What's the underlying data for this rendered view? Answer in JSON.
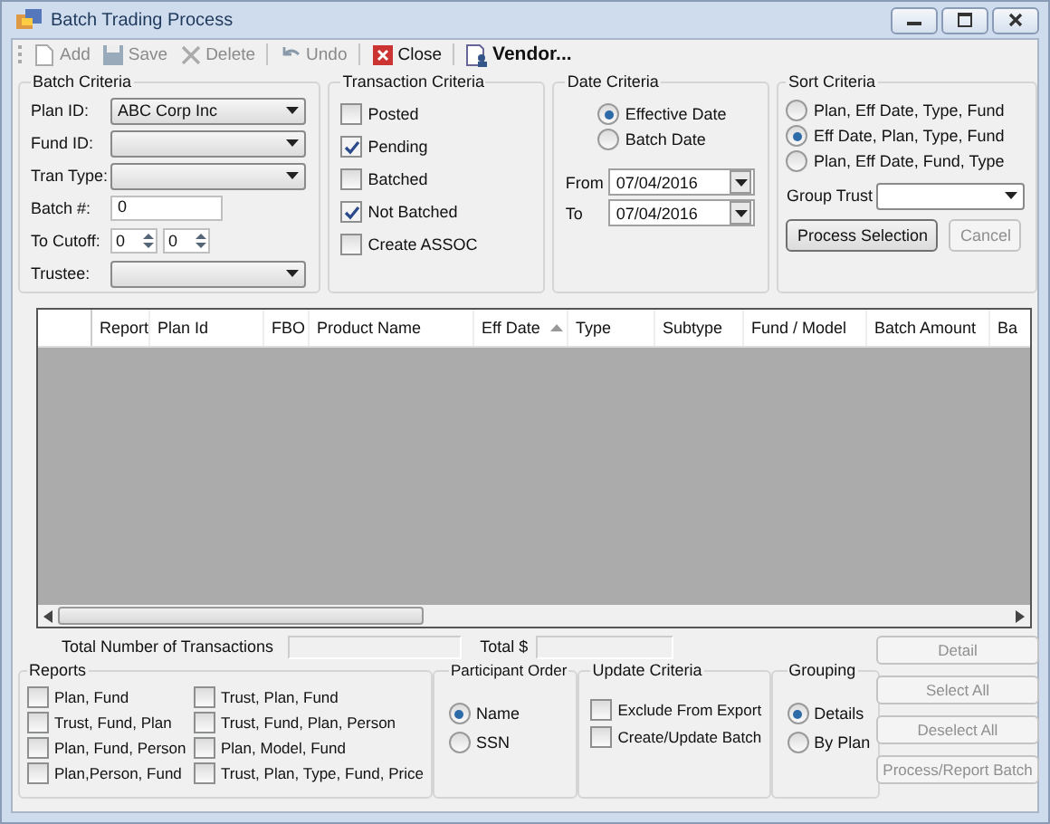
{
  "window": {
    "title": "Batch Trading  Process"
  },
  "toolbar": [
    {
      "kind": "add",
      "label": "Add",
      "disabled": true
    },
    {
      "kind": "save",
      "label": "Save",
      "disabled": true
    },
    {
      "kind": "delete",
      "label": "Delete",
      "disabled": true
    },
    {
      "kind": "undo",
      "label": "Undo",
      "disabled": true
    },
    {
      "kind": "close",
      "label": "Close",
      "disabled": false
    },
    {
      "kind": "vendor",
      "label": "Vendor...",
      "disabled": false
    }
  ],
  "batch_criteria": {
    "title": "Batch Criteria",
    "fields": [
      {
        "kind": "combo",
        "label": "Plan ID:",
        "value": "ABC Corp Inc"
      },
      {
        "kind": "combo",
        "label": "Fund ID:"
      },
      {
        "kind": "combo",
        "label": "Tran Type:"
      },
      {
        "kind": "text",
        "label": "Batch #:",
        "value": "0"
      },
      {
        "kind": "spin",
        "label": "To Cutoff:",
        "values": [
          "0",
          "0"
        ]
      },
      {
        "kind": "combo",
        "label": "Trustee:"
      }
    ]
  },
  "transaction_criteria": {
    "title": "Transaction Criteria",
    "checkboxes": [
      {
        "label": "Posted",
        "checked": false
      },
      {
        "label": "Pending",
        "checked": true
      },
      {
        "label": "Batched",
        "checked": false
      },
      {
        "label": "Not Batched",
        "checked": true
      },
      {
        "label": "Create ASSOC",
        "checked": false
      }
    ]
  },
  "date_criteria": {
    "title": "Date Criteria",
    "options": [
      {
        "label": "Effective Date",
        "selected": true
      },
      {
        "label": "Batch Date",
        "selected": false
      }
    ],
    "dates": [
      {
        "label": "From",
        "value": "07/04/2016"
      },
      {
        "label": "To",
        "value": "07/04/2016"
      }
    ]
  },
  "sort_criteria": {
    "title": "Sort Criteria",
    "options": [
      {
        "label": "Plan, Eff Date, Type, Fund",
        "selected": false
      },
      {
        "label": "Eff Date, Plan, Type, Fund",
        "selected": true
      },
      {
        "label": "Plan, Eff Date, Fund, Type",
        "selected": false
      }
    ],
    "group_trust": {
      "label": "Group Trust"
    },
    "buttons": [
      {
        "label": "Process Selection",
        "disabled": false
      },
      {
        "label": "Cancel",
        "disabled": true
      }
    ]
  },
  "grid": {
    "columns": [
      {
        "label": "Report",
        "sorted": false
      },
      {
        "label": "Plan Id",
        "sorted": false
      },
      {
        "label": "FBO",
        "sorted": false
      },
      {
        "label": "Product Name",
        "sorted": false
      },
      {
        "label": "Eff Date",
        "sorted": true
      },
      {
        "label": "Type",
        "sorted": false
      },
      {
        "label": "Subtype",
        "sorted": false
      },
      {
        "label": "Fund / Model",
        "sorted": false
      },
      {
        "label": "Batch Amount",
        "sorted": false
      },
      {
        "label": "Ba",
        "sorted": false
      }
    ]
  },
  "totals": [
    {
      "label": "Total Number of Transactions"
    },
    {
      "label": "Total $"
    }
  ],
  "reports": {
    "title": "Reports",
    "checkboxes": [
      {
        "label": "Plan, Fund",
        "checked": false
      },
      {
        "label": "Trust, Fund, Plan",
        "checked": false
      },
      {
        "label": "Plan, Fund, Person",
        "checked": false
      },
      {
        "label": "Plan,Person, Fund",
        "checked": false
      },
      {
        "label": "Trust, Plan, Fund",
        "checked": false
      },
      {
        "label": "Trust, Fund, Plan, Person",
        "checked": false
      },
      {
        "label": "Plan, Model, Fund",
        "checked": false
      },
      {
        "label": "Trust, Plan, Type, Fund, Price",
        "checked": false
      }
    ]
  },
  "participant_order": {
    "title": "Participant Order",
    "options": [
      {
        "label": "Name",
        "selected": true
      },
      {
        "label": "SSN",
        "selected": false
      }
    ]
  },
  "update_criteria": {
    "title": "Update Criteria",
    "checkboxes": [
      {
        "label": "Exclude From Export",
        "checked": false
      },
      {
        "label": "Create/Update Batch",
        "checked": false
      }
    ]
  },
  "grouping": {
    "title": "Grouping",
    "options": [
      {
        "label": "Details",
        "selected": true
      },
      {
        "label": "By Plan",
        "selected": false
      }
    ]
  },
  "action_buttons": [
    {
      "label": "Detail",
      "disabled": true
    },
    {
      "label": "Select All",
      "disabled": true
    },
    {
      "label": "Deselect All",
      "disabled": true
    },
    {
      "label": "Process/Report Batch",
      "disabled": true
    }
  ]
}
